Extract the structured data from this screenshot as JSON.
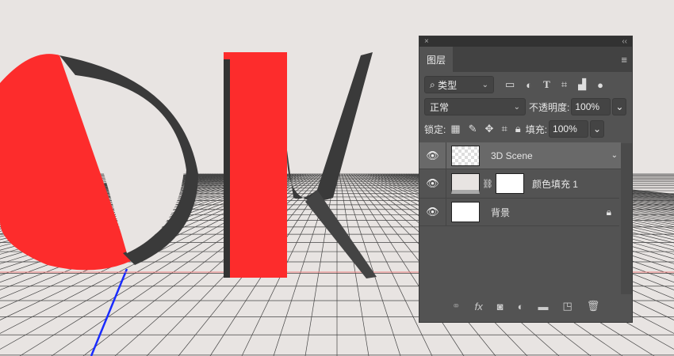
{
  "panel": {
    "close": "×",
    "collapse": "‹‹",
    "tab": "图层",
    "menu_icon": "hamburger-menu-icon",
    "filter": {
      "label": "类型",
      "icons": [
        "image-filter-icon",
        "adjustment-filter-icon",
        "type-filter-icon",
        "shape-filter-icon",
        "smart-object-filter-icon",
        "filter-toggle-icon"
      ]
    },
    "blend_mode": "正常",
    "opacity_label": "不透明度:",
    "opacity": "100%",
    "lock_label": "锁定:",
    "fill_label": "填充:",
    "fill": "100%",
    "layers": [
      {
        "name": "3D Scene",
        "selected": true
      },
      {
        "name": "颜色填充 1"
      },
      {
        "name": "背景",
        "locked": true
      }
    ],
    "bottom_icons": [
      "link-icon",
      "fx-icon",
      "mask-icon",
      "adjustment-icon",
      "folder-icon",
      "new-layer-icon",
      "trash-icon"
    ],
    "fx": "fx"
  },
  "colors": {
    "red": "#fd2c2c",
    "bg": "#e8e4e2",
    "panel": "#535353"
  }
}
